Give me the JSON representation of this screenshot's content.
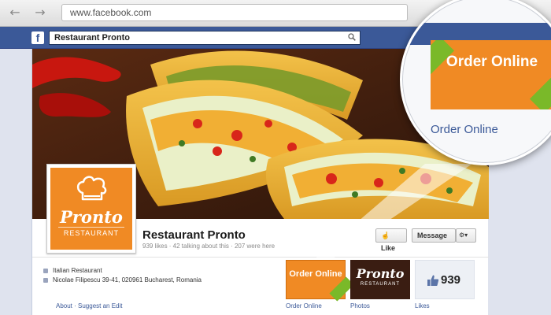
{
  "browser": {
    "url": "www.facebook.com",
    "back_icon": "arrow-left-icon",
    "forward_icon": "arrow-right-icon"
  },
  "facebook_bar": {
    "logo": "f",
    "search_value": "Restaurant Pronto",
    "search_icon": "search-icon"
  },
  "page": {
    "name": "Restaurant Pronto",
    "stats": "939 likes · 42 talking about this · 207 were here",
    "profile_logo": {
      "word": "Pronto",
      "sub": "RESTAURANT"
    },
    "buttons": {
      "like": "Like",
      "message": "Message",
      "settings_icon": "gear-icon"
    },
    "info": [
      "Italian Restaurant",
      "Nicolae Filipescu 39-41, 020961 Bucharest, Romania"
    ],
    "info_links": "About · Suggest an Edit",
    "apps": [
      {
        "label": "Order Online",
        "tile_text": "Order Online"
      },
      {
        "label": "Photos",
        "tile_word": "Pronto",
        "tile_sub": "RESTAURANT"
      },
      {
        "label": "Likes",
        "count": "939"
      }
    ]
  },
  "magnifier": {
    "tile_text": "Order Online",
    "label": "Order Online"
  },
  "colors": {
    "facebook_blue": "#3b5998",
    "brand_orange": "#f08a24",
    "brand_green": "#7ab929"
  }
}
